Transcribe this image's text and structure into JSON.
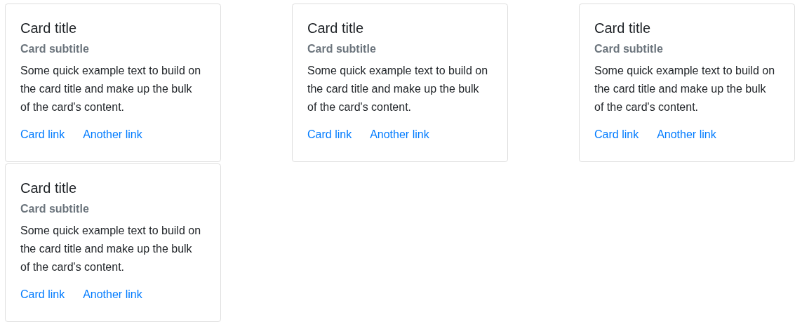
{
  "cards": [
    {
      "title": "Card title",
      "subtitle": "Card subtitle",
      "text": "Some quick example text to build on the card title and make up the bulk of the card's content.",
      "links": [
        "Card link",
        "Another link"
      ]
    },
    {
      "title": "Card title",
      "subtitle": "Card subtitle",
      "text": "Some quick example text to build on the card title and make up the bulk of the card's content.",
      "links": [
        "Card link",
        "Another link"
      ]
    },
    {
      "title": "Card title",
      "subtitle": "Card subtitle",
      "text": "Some quick example text to build on the card title and make up the bulk of the card's content.",
      "links": [
        "Card link",
        "Another link"
      ]
    },
    {
      "title": "Card title",
      "subtitle": "Card subtitle",
      "text": "Some quick example text to build on the card title and make up the bulk of the card's content.",
      "links": [
        "Card link",
        "Another link"
      ]
    }
  ]
}
